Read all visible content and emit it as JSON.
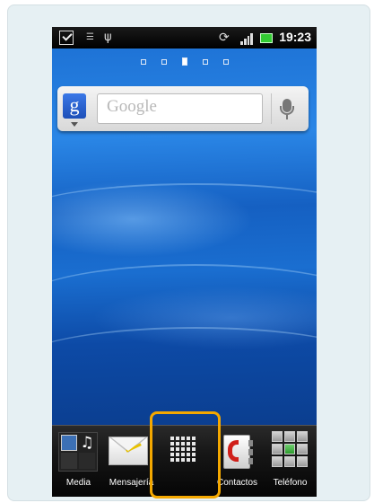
{
  "status_bar": {
    "time": "19:23",
    "icons": [
      "checkbox-icon",
      "missed-call-icon",
      "usb-icon",
      "rotation-icon",
      "signal-icon",
      "battery-icon"
    ]
  },
  "home_screens": {
    "count": 5,
    "active_index": 2
  },
  "search_widget": {
    "placeholder": "Google",
    "logo": "g",
    "mic": "microphone-icon"
  },
  "dock": {
    "items": [
      {
        "label": "Media",
        "icon": "media-icon"
      },
      {
        "label": "Mensajería",
        "icon": "envelope-icon"
      },
      {
        "label": "",
        "icon": "app-grid-icon"
      },
      {
        "label": "Contactos",
        "icon": "contacts-icon"
      },
      {
        "label": "Teléfono",
        "icon": "dialpad-icon"
      }
    ]
  },
  "highlight": {
    "color": "#f4a800",
    "target": "app-grid-icon"
  }
}
